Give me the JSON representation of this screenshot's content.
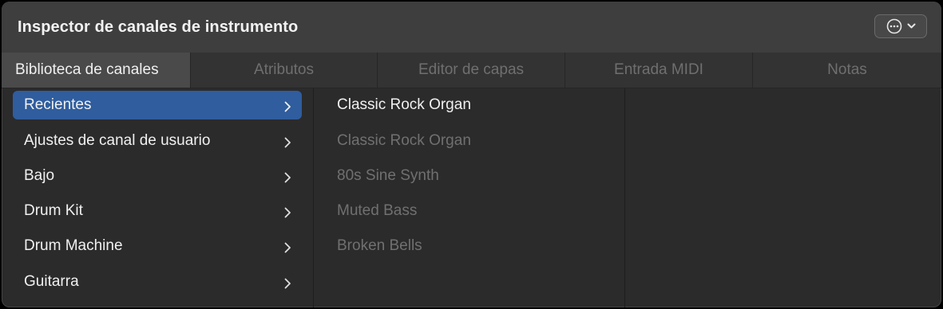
{
  "window": {
    "title": "Inspector de canales de instrumento",
    "menu_button_icon": "ellipsis-circle-icon"
  },
  "tabs": [
    {
      "label": "Biblioteca de canales",
      "active": true
    },
    {
      "label": "Atributos",
      "active": false
    },
    {
      "label": "Editor de capas",
      "active": false
    },
    {
      "label": "Entrada MIDI",
      "active": false
    },
    {
      "label": "Notas",
      "active": false
    }
  ],
  "categories": [
    {
      "label": "Recientes",
      "selected": true
    },
    {
      "label": "Ajustes de canal de usuario",
      "selected": false
    },
    {
      "label": "Bajo",
      "selected": false
    },
    {
      "label": "Drum Kit",
      "selected": false
    },
    {
      "label": "Drum Machine",
      "selected": false
    },
    {
      "label": "Guitarra",
      "selected": false
    }
  ],
  "recent_items": [
    {
      "label": "Classic Rock Organ",
      "current": true
    },
    {
      "label": "Classic Rock Organ",
      "current": false
    },
    {
      "label": "80s Sine Synth",
      "current": false
    },
    {
      "label": "Muted Bass",
      "current": false
    },
    {
      "label": "Broken Bells",
      "current": false
    }
  ],
  "colors": {
    "selection": "#2f5d9e",
    "background": "#2b2b2b",
    "titlebar": "#3e3e3e"
  }
}
